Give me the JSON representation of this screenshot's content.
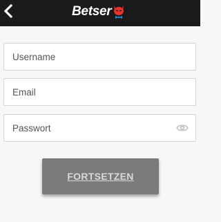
{
  "header": {
    "back_icon": "chevron-left-icon",
    "logo_text": "Betser",
    "logo_icon": "devil-mascot-icon",
    "background": "#1a1a1a"
  },
  "form": {
    "username_placeholder": "Username",
    "username_value": "",
    "email_placeholder": "Email",
    "email_value": "",
    "password_placeholder": "Passwort",
    "password_value": "",
    "password_toggle_icon": "eye-icon",
    "submit_label": "FORTSETZEN",
    "submit_color": "#7b7b7b"
  },
  "colors": {
    "accent_red": "#e5352b",
    "bowtie_blue": "#1e90d6"
  }
}
